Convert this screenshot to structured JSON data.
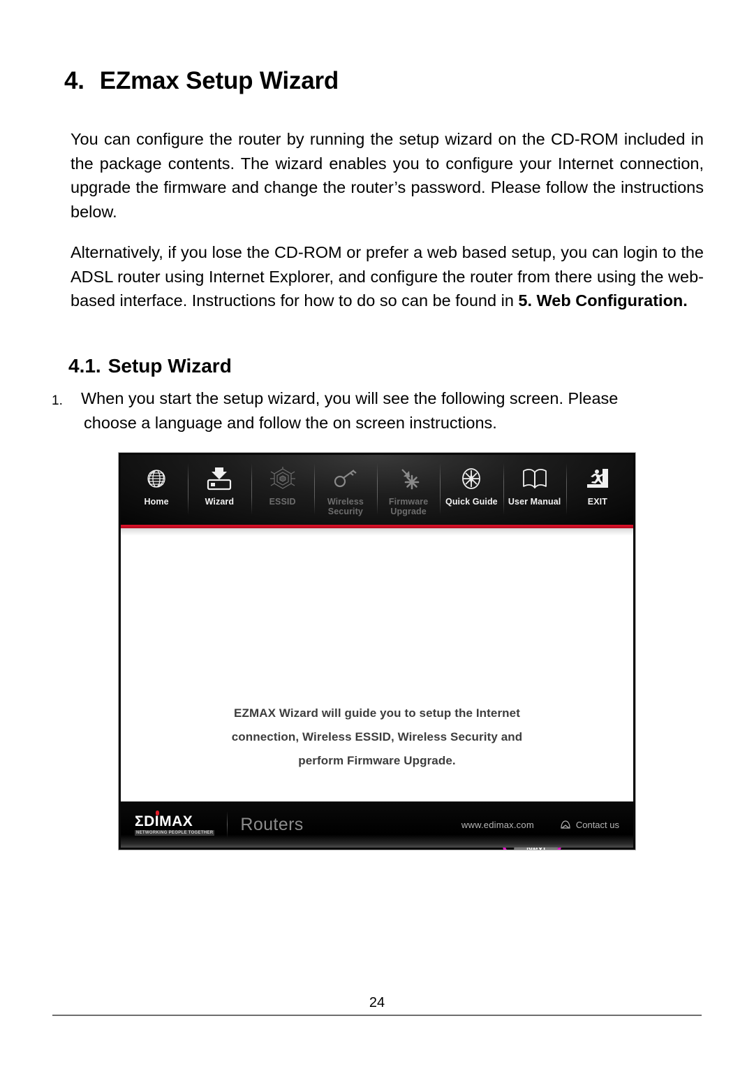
{
  "document": {
    "heading": {
      "number": "4.",
      "title": "EZmax Setup Wizard"
    },
    "paragraph_1": "You can configure the router by running the setup wizard on the CD-ROM included in the package contents. The wizard enables you to configure your Internet connection, upgrade the firmware and change the router’s password. Please follow the instructions below.",
    "paragraph_2_part1": "Alternatively, if you lose the CD-ROM or prefer a web based setup, you can login to the ADSL router using Internet Explorer, and configure the router from there using the web-based interface. Instructions for how to do so can be found in ",
    "paragraph_2_bold": "5. Web Configuration.",
    "subheading": {
      "number": "4.1.",
      "title": "Setup Wizard"
    },
    "list_item_1": {
      "marker": "1.",
      "line1": "When you start the setup wizard, you will see the following screen. Please",
      "line2": "choose a language and follow the on screen instructions."
    },
    "page_number": "24"
  },
  "wizard_screenshot": {
    "toolbar": [
      {
        "label": "Home",
        "icon": "globe-icon",
        "enabled": true
      },
      {
        "label": "Wizard",
        "icon": "download-device-icon",
        "enabled": true
      },
      {
        "label": "ESSID",
        "icon": "wireless-web-icon",
        "enabled": false
      },
      {
        "label1": "Wireless",
        "label2": "Security",
        "icon": "key-icon",
        "enabled": false
      },
      {
        "label1": "Firmware",
        "label2": "Upgrade",
        "icon": "download-star-icon",
        "enabled": false
      },
      {
        "label": "Quick Guide",
        "icon": "compass-icon",
        "enabled": true
      },
      {
        "label": "User Manual",
        "icon": "open-book-icon",
        "enabled": true
      },
      {
        "label": "EXIT",
        "icon": "exit-door-icon",
        "enabled": true
      }
    ],
    "message": {
      "line1": "EZMAX Wizard will guide you to setup the Internet",
      "line2": "connection, Wireless ESSID, Wireless Security and",
      "line3": "perform Firmware Upgrade."
    },
    "next_button": "Next",
    "highlight_color": "#e215c8",
    "accent_color": "#e1132a",
    "footer": {
      "brand": "ΣDIMAX",
      "tagline": "NETWORKING PEOPLE TOGETHER",
      "category": "Routers",
      "website": "www.edimax.com",
      "contact": "Contact us"
    }
  }
}
